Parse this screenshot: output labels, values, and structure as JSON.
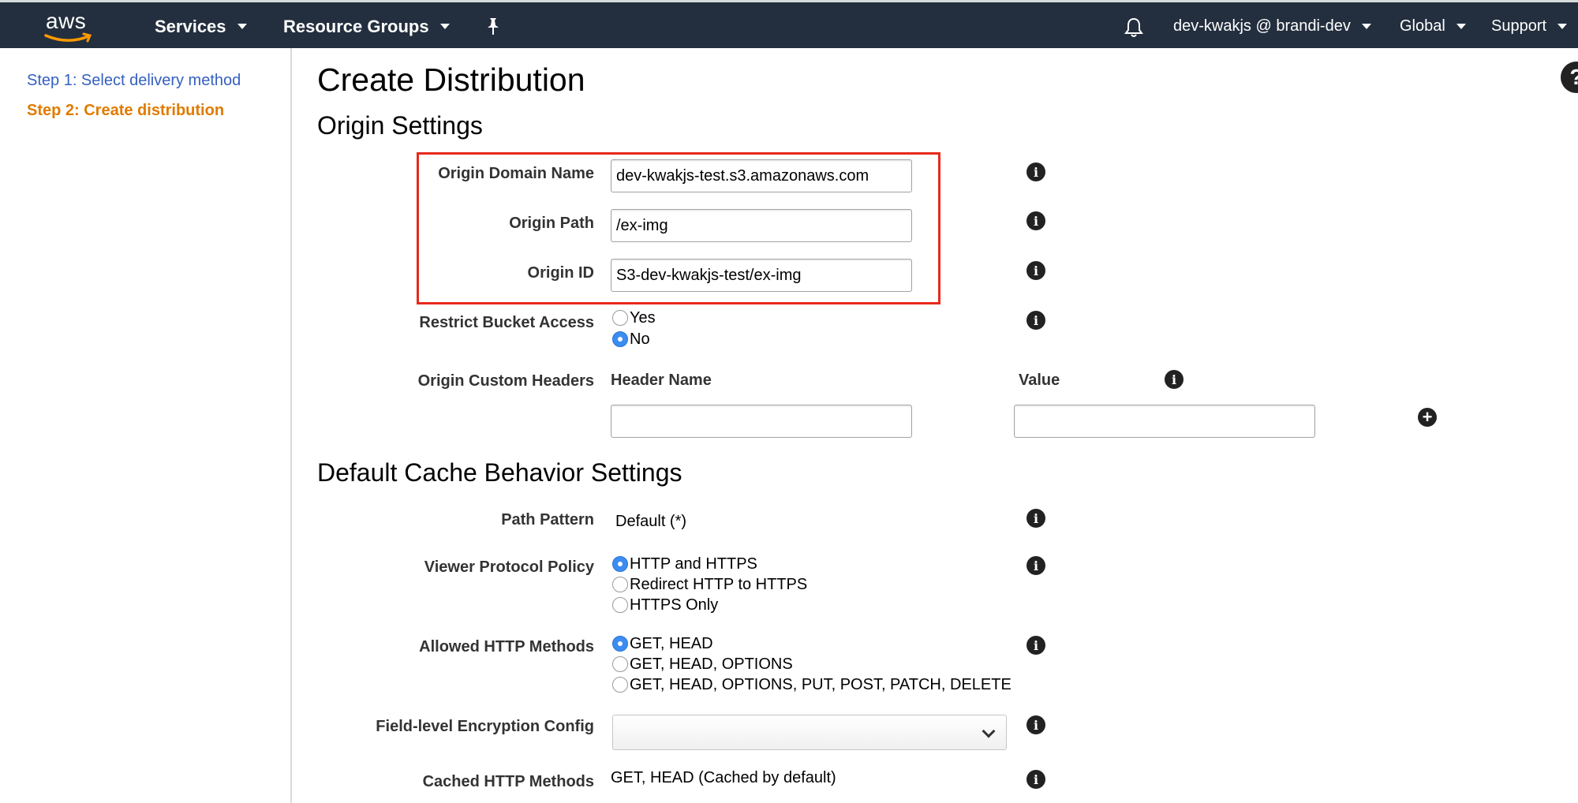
{
  "nav": {
    "logo": "aws",
    "services": "Services",
    "resource_groups": "Resource Groups",
    "account": "dev-kwakjs @ brandi-dev",
    "region": "Global",
    "support": "Support"
  },
  "sidebar": {
    "steps": [
      {
        "label": "Step 1: Select delivery method",
        "active": false
      },
      {
        "label": "Step 2: Create distribution",
        "active": true
      }
    ]
  },
  "page": {
    "title": "Create Distribution",
    "help_glyph": "?"
  },
  "origin": {
    "section_title": "Origin Settings",
    "domain_label": "Origin Domain Name",
    "domain_value": "dev-kwakjs-test.s3.amazonaws.com",
    "path_label": "Origin Path",
    "path_value": "/ex-img",
    "id_label": "Origin ID",
    "id_value": "S3-dev-kwakjs-test/ex-img",
    "restrict_label": "Restrict Bucket Access",
    "restrict_options": [
      "Yes",
      "No"
    ],
    "restrict_selected": "No",
    "headers_label": "Origin Custom Headers",
    "header_name_col": "Header Name",
    "value_col": "Value",
    "header_name_value": "",
    "header_value_value": ""
  },
  "cache": {
    "section_title": "Default Cache Behavior Settings",
    "path_pattern_label": "Path Pattern",
    "path_pattern_value": "Default (*)",
    "viewer_label": "Viewer Protocol Policy",
    "viewer_options": [
      "HTTP and HTTPS",
      "Redirect HTTP to HTTPS",
      "HTTPS Only"
    ],
    "viewer_selected": "HTTP and HTTPS",
    "methods_label": "Allowed HTTP Methods",
    "methods_options": [
      "GET, HEAD",
      "GET, HEAD, OPTIONS",
      "GET, HEAD, OPTIONS, PUT, POST, PATCH, DELETE"
    ],
    "methods_selected": "GET, HEAD",
    "fle_label": "Field-level Encryption Config",
    "fle_value": "",
    "cached_label": "Cached HTTP Methods",
    "cached_value": "GET, HEAD (Cached by default)"
  },
  "colors": {
    "nav_bg": "#232f3e",
    "link_blue": "#3560c0",
    "active_orange": "#e07b00",
    "highlight_red": "#e8291c",
    "radio_blue": "#3d8cf0"
  },
  "icons": {
    "info": "info-icon",
    "add": "plus-circle-icon",
    "notifications": "bell-icon",
    "pin": "pin-icon"
  }
}
